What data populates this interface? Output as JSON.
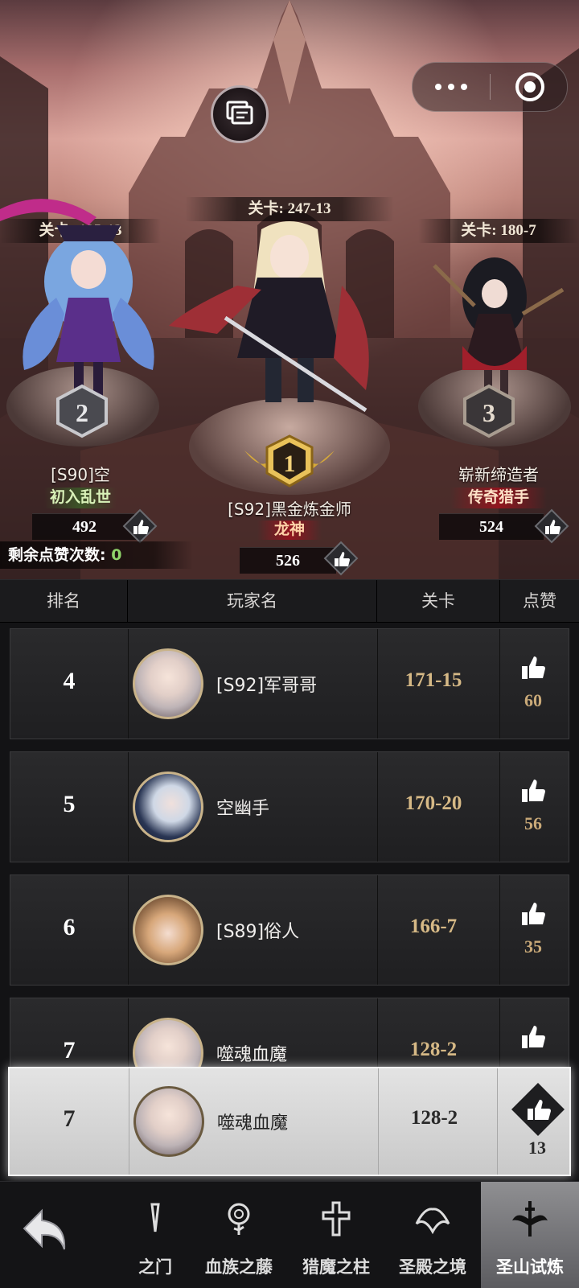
{
  "podium": {
    "center": {
      "stage": "关卡: 247-13",
      "rank": "1",
      "name": "[S92]黑金炼金师",
      "title": "龙神",
      "likes": "526"
    },
    "left": {
      "stage": "关卡: 185-13",
      "rank": "2",
      "name": "[S90]空",
      "title": "初入乱世",
      "likes": "492"
    },
    "right": {
      "stage": "关卡: 180-7",
      "rank": "3",
      "name": "崭新缔造者",
      "title": "传奇猎手",
      "likes": "524"
    }
  },
  "remaining_likes": {
    "label": "剩余点赞次数:",
    "value": "0"
  },
  "table": {
    "headers": [
      "排名",
      "玩家名",
      "关卡",
      "点赞"
    ],
    "rows": [
      {
        "rank": "4",
        "name": "[S92]军哥哥",
        "stage": "171-15",
        "likes": "60"
      },
      {
        "rank": "5",
        "name": "空幽手",
        "stage": "170-20",
        "likes": "56"
      },
      {
        "rank": "6",
        "name": "[S89]俗人",
        "stage": "166-7",
        "likes": "35"
      },
      {
        "rank": "7",
        "name": "噬魂血魔",
        "stage": "128-2",
        "likes": ""
      }
    ]
  },
  "self_row": {
    "rank": "7",
    "name": "噬魂血魔",
    "stage": "128-2",
    "likes": "13"
  },
  "nav": {
    "items": [
      {
        "label": "之门",
        "icon": "gate-icon"
      },
      {
        "label": "血族之藤",
        "icon": "rose-icon"
      },
      {
        "label": "猎魔之柱",
        "icon": "cross-icon"
      },
      {
        "label": "圣殿之境",
        "icon": "wing-icon"
      },
      {
        "label": "圣山试炼",
        "icon": "sword-wings-icon"
      }
    ]
  },
  "colors": {
    "accent_gold": "#d6b986",
    "likes_gold": "#c9a978",
    "remaining_green": "#8fd46a",
    "title_red": "#b3202a"
  }
}
